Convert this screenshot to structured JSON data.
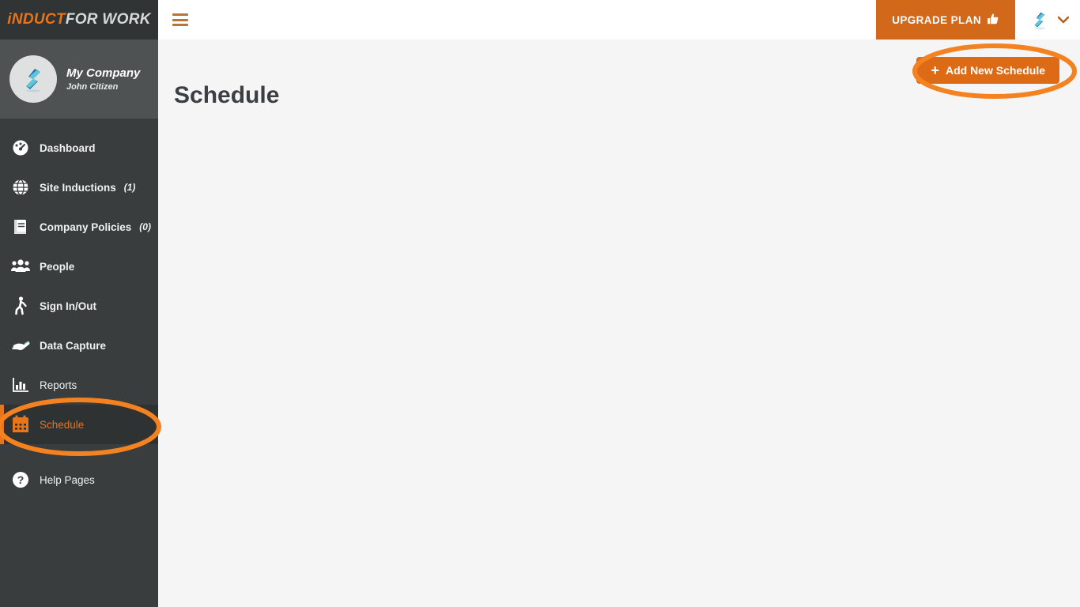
{
  "brand": {
    "primary": "iNDUCT",
    "secondary": "FOR WORK",
    "primary_color": "#e8751a",
    "secondary_color": "#d8dada"
  },
  "profile": {
    "company": "My Company",
    "user": "John Citizen",
    "avatar_icon": "company-logo-icon"
  },
  "sidebar": {
    "items": [
      {
        "label": "Dashboard",
        "icon": "dashboard-gauge-icon",
        "count": "",
        "active": false,
        "bold": true
      },
      {
        "label": "Site Inductions",
        "icon": "globe-icon",
        "count": "(1)",
        "active": false,
        "bold": true
      },
      {
        "label": "Company Policies",
        "icon": "book-icon",
        "count": "(0)",
        "active": false,
        "bold": true
      },
      {
        "label": "People",
        "icon": "people-icon",
        "count": "",
        "active": false,
        "bold": true
      },
      {
        "label": "Sign In/Out",
        "icon": "walking-person-icon",
        "count": "",
        "active": false,
        "bold": true
      },
      {
        "label": "Data Capture",
        "icon": "hand-icon",
        "count": "",
        "active": false,
        "bold": true
      },
      {
        "label": "Reports",
        "icon": "bar-chart-icon",
        "count": "",
        "active": false,
        "bold": false
      },
      {
        "label": "Schedule",
        "icon": "calendar-icon",
        "count": "",
        "active": true,
        "bold": false
      },
      {
        "label": "Help Pages",
        "icon": "question-mark-icon",
        "count": "",
        "active": false,
        "bold": false
      }
    ]
  },
  "header": {
    "menu_toggle_icon": "hamburger-icon",
    "upgrade_label": "UPGRADE PLAN",
    "upgrade_icon": "thumbs-up-icon",
    "upgrade_bg": "#d2691a",
    "avatar_icon": "company-logo-icon",
    "caret_icon": "chevron-down-icon"
  },
  "main": {
    "page_title": "Schedule",
    "add_button_label": "Add New Schedule",
    "add_button_icon": "plus-icon",
    "add_button_bg": "#dd6b16"
  },
  "annotations": {
    "accent_color": "#f58220",
    "targets": [
      "add-new-schedule-button",
      "sidebar-item-schedule"
    ]
  }
}
